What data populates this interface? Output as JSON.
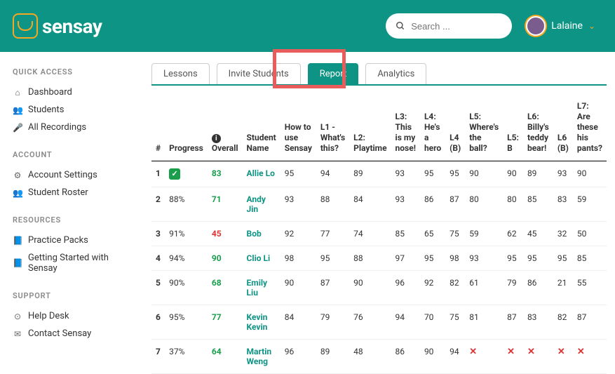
{
  "brand": "sensay",
  "search": {
    "placeholder": "Search ..."
  },
  "user": {
    "name": "Lalaine"
  },
  "sidebar": {
    "sections": [
      {
        "heading": "QUICK ACCESS",
        "items": [
          {
            "icon": "⌂",
            "label": "Dashboard"
          },
          {
            "icon": "👥",
            "label": "Students"
          },
          {
            "icon": "🎤",
            "label": "All Recordings"
          }
        ]
      },
      {
        "heading": "ACCOUNT",
        "items": [
          {
            "icon": "⚙",
            "label": "Account Settings"
          },
          {
            "icon": "👥",
            "label": "Student Roster"
          }
        ]
      },
      {
        "heading": "RESOURCES",
        "items": [
          {
            "icon": "📘",
            "label": "Practice Packs"
          },
          {
            "icon": "📘",
            "label": "Getting Started with Sensay"
          }
        ]
      },
      {
        "heading": "SUPPORT",
        "items": [
          {
            "icon": "⊙",
            "label": "Help Desk"
          },
          {
            "icon": "✉",
            "label": "Contact Sensay"
          }
        ]
      }
    ]
  },
  "tabs": [
    {
      "label": "Lessons",
      "active": false
    },
    {
      "label": "Invite Students",
      "active": false
    },
    {
      "label": "Report",
      "active": true
    },
    {
      "label": "Analytics",
      "active": false
    }
  ],
  "columns": [
    "#",
    "Progress",
    "Overall",
    "Student Name",
    "How to use Sensay",
    "L1 - What's this?",
    "L2: Playtime",
    "L3: This is my nose!",
    "L4: He's a hero",
    "L4 (B)",
    "L5: Where's the ball?",
    "L5: B",
    "L6: Billy's teddy bear!",
    "L6 (B)",
    "L7: Are these his pants?"
  ],
  "rows": [
    {
      "n": 1,
      "progress": "CHECK",
      "overall": 83,
      "overallClass": "green",
      "name": "Allie Lo",
      "cells": [
        "95",
        "94",
        "89",
        "93",
        "95",
        "95",
        "90",
        "90",
        "89",
        "93",
        "90"
      ]
    },
    {
      "n": 2,
      "progress": "88%",
      "overall": 71,
      "overallClass": "green",
      "name": "Andy Jin",
      "cells": [
        "93",
        "88",
        "84",
        "93",
        "86",
        "87",
        "80",
        "80",
        "85",
        "83",
        "59"
      ]
    },
    {
      "n": 3,
      "progress": "91%",
      "overall": 45,
      "overallClass": "red",
      "name": "Bob",
      "cells": [
        "92",
        "77",
        "74",
        "85",
        "65",
        "75",
        "59",
        "62",
        "45",
        "32",
        "50"
      ]
    },
    {
      "n": 4,
      "progress": "94%",
      "overall": 90,
      "overallClass": "green",
      "name": "Clio Li",
      "cells": [
        "98",
        "95",
        "88",
        "97",
        "95",
        "98",
        "93",
        "95",
        "95",
        "95",
        "85"
      ]
    },
    {
      "n": 5,
      "progress": "90%",
      "overall": 68,
      "overallClass": "green",
      "name": "Emily Liu",
      "cells": [
        "90",
        "87",
        "90",
        "96",
        "92",
        "82",
        "61",
        "79",
        "86",
        "21",
        "55"
      ]
    },
    {
      "n": 6,
      "progress": "95%",
      "overall": 77,
      "overallClass": "green",
      "name": "Kevin Kevin",
      "cells": [
        "84",
        "79",
        "76",
        "94",
        "70",
        "75",
        "81",
        "87",
        "83",
        "82",
        "87"
      ]
    },
    {
      "n": 7,
      "progress": "37%",
      "overall": 64,
      "overallClass": "green",
      "name": "Martin Weng",
      "cells": [
        "96",
        "89",
        "48",
        "86",
        "90",
        "94",
        "X",
        "X",
        "X",
        "X",
        "X"
      ]
    }
  ]
}
